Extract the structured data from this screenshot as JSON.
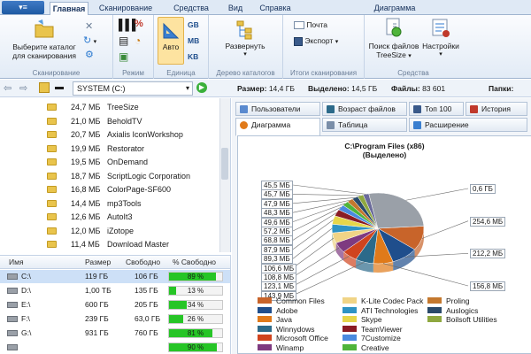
{
  "ribbon": {
    "tabs": [
      "Главная",
      "Сканирование",
      "Средства",
      "Вид",
      "Справка",
      "Диаграмма"
    ],
    "active_tab": "Главная",
    "scan_group": {
      "label": "Сканирование",
      "select_button": [
        "Выберите каталог",
        "для сканирования"
      ]
    },
    "mode_group": {
      "label": "Режим",
      "percent_symbol": "%"
    },
    "unit_group": {
      "label": "Единица",
      "auto_label": "Авто",
      "units": [
        "GB",
        "MB",
        "KB"
      ]
    },
    "tree_group": {
      "label": "Дерево каталогов",
      "expand_label": "Развернуть"
    },
    "results_group": {
      "label": "Итоги сканирования",
      "mail_label": "Почта",
      "export_label": "Экспорт"
    },
    "tools_group": {
      "label": "Средства",
      "search_label": [
        "Поиск файлов",
        "TreeSize"
      ],
      "settings_label": "Настройки"
    }
  },
  "address": {
    "path": "SYSTEM (C:)",
    "size_label": "Размер:",
    "size_value": "14,4 ГБ",
    "alloc_label": "Выделено:",
    "alloc_value": "14,5 ГБ",
    "files_label": "Файлы:",
    "files_value": "83 601",
    "folders_label": "Папки:"
  },
  "tree": [
    {
      "size": "24,7 МБ",
      "name": "TreeSize"
    },
    {
      "size": "21,0 МБ",
      "name": "BeholdTV"
    },
    {
      "size": "20,7 МБ",
      "name": "Axialis IconWorkshop"
    },
    {
      "size": "19,9 МБ",
      "name": "Restorator"
    },
    {
      "size": "19,5 МБ",
      "name": "OnDemand"
    },
    {
      "size": "18,7 МБ",
      "name": "ScriptLogic Corporation"
    },
    {
      "size": "16,8 МБ",
      "name": "ColorPage-SF600"
    },
    {
      "size": "14,4 МБ",
      "name": "mp3Tools"
    },
    {
      "size": "12,6 МБ",
      "name": "AutoIt3"
    },
    {
      "size": "12,0 МБ",
      "name": "iZotope"
    },
    {
      "size": "11,4 МБ",
      "name": "Download Master"
    }
  ],
  "drives": {
    "headers": [
      "Имя",
      "Размер",
      "Свободно",
      "% Свободно"
    ],
    "rows": [
      {
        "name": "C:\\",
        "size": "119 ГБ",
        "free": "106 ГБ",
        "pct": 89,
        "pct_label": "89 %"
      },
      {
        "name": "D:\\",
        "size": "1,00 ТБ",
        "free": "135 ГБ",
        "pct": 13,
        "pct_label": "13 %"
      },
      {
        "name": "E:\\",
        "size": "600 ГБ",
        "free": "205 ГБ",
        "pct": 34,
        "pct_label": "34 %"
      },
      {
        "name": "F:\\",
        "size": "239 ГБ",
        "free": "63,0 ГБ",
        "pct": 26,
        "pct_label": "26 %"
      },
      {
        "name": "G:\\",
        "size": "931 ГБ",
        "free": "760 ГБ",
        "pct": 81,
        "pct_label": "81 %"
      },
      {
        "name": "",
        "size": "",
        "free": "",
        "pct": 90,
        "pct_label": "90 %"
      }
    ]
  },
  "chart_tabs": {
    "top": [
      "Пользователи",
      "Возраст файлов",
      "Топ 100",
      "История"
    ],
    "bottom": [
      "Диаграмма",
      "Таблица",
      "Расширение"
    ]
  },
  "chart_data": {
    "type": "pie",
    "title": "C:\\Program Files (x86)",
    "subtitle": "(Выделено)",
    "slices": [
      {
        "label": "Common Files",
        "value_label": "254,6 МБ",
        "value": 254.6,
        "color": "#c8642a"
      },
      {
        "label": "Adobe",
        "value_label": "212,2 МБ",
        "value": 212.2,
        "color": "#1f4e8c"
      },
      {
        "label": "Java",
        "value_label": "156,8 МБ",
        "value": 156.8,
        "color": "#e07a1a"
      },
      {
        "label": "Winnydows",
        "value_label": "143,9 МБ",
        "value": 143.9,
        "color": "#2c6a8a"
      },
      {
        "label": "Microsoft Office",
        "value_label": "123,1 МБ",
        "value": 123.1,
        "color": "#d0441e"
      },
      {
        "label": "Winamp",
        "value_label": "108,8 МБ",
        "value": 108.8,
        "color": "#7e3a80"
      },
      {
        "label": "K-Lite Codec Pack",
        "value_label": "106,6 МБ",
        "value": 106.6,
        "color": "#f0d486"
      },
      {
        "label": "ATI Technologies",
        "value_label": "89,3 МБ",
        "value": 89.3,
        "color": "#2e93c4"
      },
      {
        "label": "Skype",
        "value_label": "87,9 МБ",
        "value": 87.9,
        "color": "#e6d64a"
      },
      {
        "label": "TeamViewer",
        "value_label": "68,8 МБ",
        "value": 68.8,
        "color": "#8a1c24"
      },
      {
        "label": "7Customize",
        "value_label": "57,2 МБ",
        "value": 57.2,
        "color": "#4a8adf"
      },
      {
        "label": "Creative",
        "value_label": "49,6 МБ",
        "value": 49.6,
        "color": "#4fb43a"
      },
      {
        "label": "Proling",
        "value_label": "48,3 МБ",
        "value": 48.3,
        "color": "#c4782e"
      },
      {
        "label": "Auslogics",
        "value_label": "47,9 МБ",
        "value": 47.9,
        "color": "#2a4a6a"
      },
      {
        "label": "Boilsoft Utilities",
        "value_label": "45,7 МБ",
        "value": 45.7,
        "color": "#8fa840"
      },
      {
        "label": "",
        "value_label": "45,5 МБ",
        "value": 45.5,
        "color": "#6a6a9a"
      },
      {
        "label": "",
        "value_label": "0,6 ГБ",
        "value": 614.4,
        "color": "#9aa0a8"
      }
    ]
  }
}
